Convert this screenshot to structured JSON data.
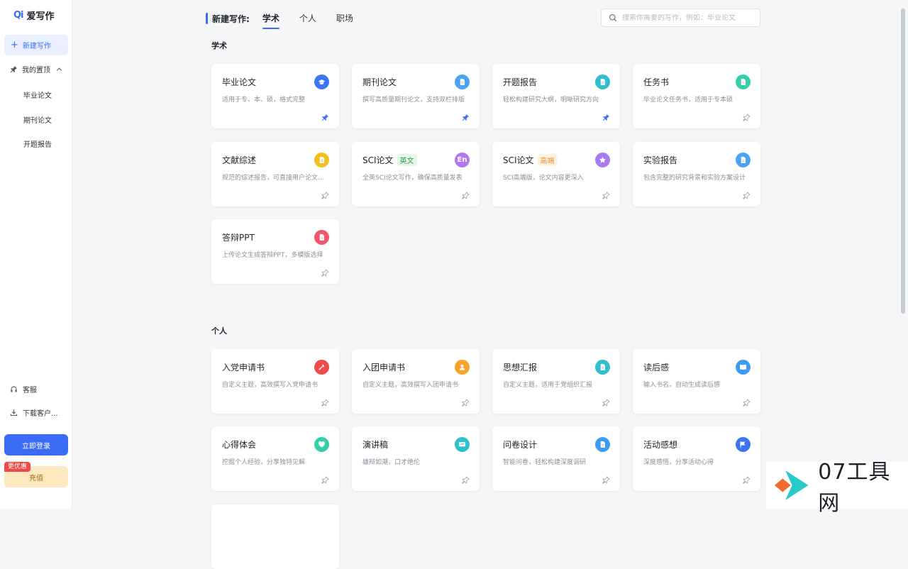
{
  "app": {
    "title": "爱写作",
    "logo_mark": "Qi"
  },
  "sidebar": {
    "new_label": "新建写作",
    "pinned_label": "我的置顶",
    "pinned_items": [
      "毕业论文",
      "期刊论文",
      "开题报告"
    ],
    "service_label": "客服",
    "download_label": "下载客户...",
    "login_label": "立即登录",
    "promo_label": "更优惠",
    "recharge_label": "充值"
  },
  "header": {
    "lead": "新建写作:",
    "tabs": [
      "学术",
      "个人",
      "职场"
    ],
    "active_tab": "学术",
    "search_placeholder": "搜索你需要的写作，例如：毕业论文"
  },
  "sections": [
    {
      "title": "学术"
    },
    {
      "title": "个人"
    }
  ],
  "cards": [
    {
      "title": "毕业论文",
      "desc": "适用于专、本、硕，格式完整",
      "icon": "graduation-cap-icon",
      "color": "#3d74f5",
      "pinned": true
    },
    {
      "title": "期刊论文",
      "desc": "撰写高质量期刊论文，支持双栏排版",
      "icon": "document-icon",
      "color": "#4aa3f5",
      "pinned": true
    },
    {
      "title": "开题报告",
      "desc": "轻松构建研究大纲，明晰研究方向",
      "icon": "document-icon",
      "color": "#2fbfce",
      "pinned": true
    },
    {
      "title": "任务书",
      "desc": "毕业论文任务书，适用于专本硕",
      "icon": "document-icon",
      "color": "#34cfa8",
      "pinned": false
    },
    {
      "title": "文献综述",
      "desc": "规范的综述报告，可直接用户论文...",
      "icon": "document-icon",
      "color": "#f3c01c",
      "pinned": false
    },
    {
      "title": "SCI论文",
      "tag": "英文",
      "tag_bg": "#e6f7e8",
      "tag_color": "#2fa24b",
      "desc": "全英SCI论文写作，确保高质量发表",
      "icon": "en-badge-icon",
      "icon_text": "En",
      "color": "#b178ef",
      "pinned": false
    },
    {
      "title": "SCI论文",
      "tag": "高端",
      "tag_bg": "#fff2e0",
      "tag_color": "#e8912d",
      "desc": "SCI高端版，论文内容更深入",
      "icon": "star-icon",
      "color": "#a67bef",
      "pinned": false
    },
    {
      "title": "实验报告",
      "desc": "包含完整的研究背景和实验方案设计",
      "icon": "document-icon",
      "color": "#4aa3f5",
      "pinned": false
    },
    {
      "title": "答辩PPT",
      "desc": "上传论文生成答辩PPT，多模版选择",
      "icon": "document-icon",
      "color": "#f2566b",
      "pinned": false
    },
    {
      "title": "入党申请书",
      "desc": "自定义主题，高效撰写入党申请书",
      "icon": "party-icon",
      "color": "#ef4b4b",
      "pinned": false
    },
    {
      "title": "入团申请书",
      "desc": "自定义主题，高效撰写入团申请书",
      "icon": "user-icon",
      "color": "#f5a32a",
      "pinned": false
    },
    {
      "title": "思想汇报",
      "desc": "自定义主题，适用于党组织汇报",
      "icon": "document-icon",
      "color": "#2fbfce",
      "pinned": false
    },
    {
      "title": "读后感",
      "desc": "输入书名，自动生成读后感",
      "icon": "book-icon",
      "color": "#3f9bf1",
      "pinned": false
    },
    {
      "title": "心得体会",
      "desc": "挖掘个人经验，分享独特见解",
      "icon": "heart-icon",
      "color": "#34cfa8",
      "pinned": false
    },
    {
      "title": "演讲稿",
      "desc": "雄辩如潮，口才绝伦",
      "icon": "presentation-icon",
      "color": "#2fbfce",
      "pinned": false
    },
    {
      "title": "问卷设计",
      "desc": "智能问卷，轻松构建深度调研",
      "icon": "document-icon",
      "color": "#3f9bf1",
      "pinned": false
    },
    {
      "title": "活动感想",
      "desc": "深度感悟，分享活动心得",
      "icon": "flag-icon",
      "color": "#3d74f5",
      "pinned": false
    }
  ],
  "watermark": {
    "text": "07工具网"
  }
}
